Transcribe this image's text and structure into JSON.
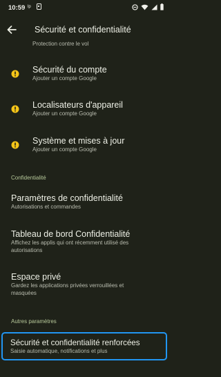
{
  "status_bar": {
    "time": "10:59",
    "small_indicator": "lp"
  },
  "app_bar": {
    "title": "Sécurité et confidentialité"
  },
  "partial_row": {
    "subtitle": "Protection contre le vol"
  },
  "security_items": [
    {
      "title": "Sécurité du compte",
      "subtitle": "Ajouter un compte Google",
      "icon": "warning-icon"
    },
    {
      "title": "Localisateurs d'appareil",
      "subtitle": "Ajouter un compte Google",
      "icon": "warning-icon"
    },
    {
      "title": "Système et mises à jour",
      "subtitle": "Ajouter un compte Google",
      "icon": "warning-icon"
    }
  ],
  "privacy_section": {
    "header": "Confidentialité",
    "items": [
      {
        "title": "Paramètres de confidentialité",
        "subtitle": "Autorisations et commandes"
      },
      {
        "title": "Tableau de bord Confidentialité",
        "subtitle_line1": "Affichez les applis qui ont récemment utilisé des",
        "subtitle_line2": "autorisations"
      },
      {
        "title": "Espace privé",
        "subtitle_line1": "Gardez les applications privées verrouillées et",
        "subtitle_line2": "masquées"
      }
    ]
  },
  "other_section": {
    "header": "Autres paramètres",
    "items": [
      {
        "title": "Sécurité et confidentialité renforcées",
        "subtitle": "Saisie automatique, notifications et plus"
      }
    ]
  },
  "colors": {
    "background": "#1f2219",
    "warning": "#f5c518",
    "section_header": "#b7c99a",
    "highlight": "#2196f3"
  }
}
